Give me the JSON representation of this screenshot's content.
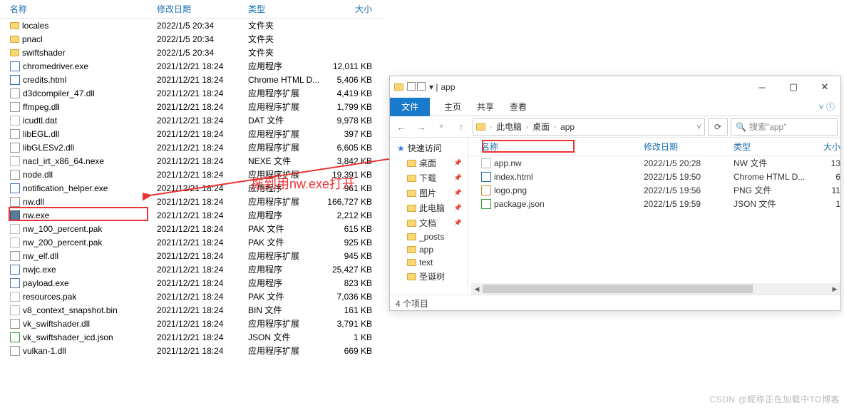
{
  "left": {
    "headers": {
      "name": "名称",
      "date": "修改日期",
      "type": "类型",
      "size": "大小"
    },
    "rows": [
      {
        "icon": "folder",
        "name": "locales",
        "date": "2022/1/5 20:34",
        "type": "文件夹",
        "size": ""
      },
      {
        "icon": "folder",
        "name": "pnacl",
        "date": "2022/1/5 20:34",
        "type": "文件夹",
        "size": ""
      },
      {
        "icon": "folder",
        "name": "swiftshader",
        "date": "2022/1/5 20:34",
        "type": "文件夹",
        "size": ""
      },
      {
        "icon": "exe",
        "name": "chromedriver.exe",
        "date": "2021/12/21 18:24",
        "type": "应用程序",
        "size": "12,011 KB"
      },
      {
        "icon": "html",
        "name": "credits.html",
        "date": "2021/12/21 18:24",
        "type": "Chrome HTML D...",
        "size": "5,406 KB"
      },
      {
        "icon": "dll",
        "name": "d3dcompiler_47.dll",
        "date": "2021/12/21 18:24",
        "type": "应用程序扩展",
        "size": "4,419 KB"
      },
      {
        "icon": "dll",
        "name": "ffmpeg.dll",
        "date": "2021/12/21 18:24",
        "type": "应用程序扩展",
        "size": "1,799 KB"
      },
      {
        "icon": "file",
        "name": "icudtl.dat",
        "date": "2021/12/21 18:24",
        "type": "DAT 文件",
        "size": "9,978 KB"
      },
      {
        "icon": "dll",
        "name": "libEGL.dll",
        "date": "2021/12/21 18:24",
        "type": "应用程序扩展",
        "size": "397 KB"
      },
      {
        "icon": "dll",
        "name": "libGLESv2.dll",
        "date": "2021/12/21 18:24",
        "type": "应用程序扩展",
        "size": "6,605 KB"
      },
      {
        "icon": "file",
        "name": "nacl_irt_x86_64.nexe",
        "date": "2021/12/21 18:24",
        "type": "NEXE 文件",
        "size": "3,842 KB"
      },
      {
        "icon": "dll",
        "name": "node.dll",
        "date": "2021/12/21 18:24",
        "type": "应用程序扩展",
        "size": "19,391 KB"
      },
      {
        "icon": "exe",
        "name": "notification_helper.exe",
        "date": "2021/12/21 18:24",
        "type": "应用程序",
        "size": "961 KB"
      },
      {
        "icon": "dll",
        "name": "nw.dll",
        "date": "2021/12/21 18:24",
        "type": "应用程序扩展",
        "size": "166,727 KB"
      },
      {
        "icon": "nw",
        "name": "nw.exe",
        "date": "2021/12/21 18:24",
        "type": "应用程序",
        "size": "2,212 KB"
      },
      {
        "icon": "file",
        "name": "nw_100_percent.pak",
        "date": "2021/12/21 18:24",
        "type": "PAK 文件",
        "size": "615 KB"
      },
      {
        "icon": "file",
        "name": "nw_200_percent.pak",
        "date": "2021/12/21 18:24",
        "type": "PAK 文件",
        "size": "925 KB"
      },
      {
        "icon": "dll",
        "name": "nw_elf.dll",
        "date": "2021/12/21 18:24",
        "type": "应用程序扩展",
        "size": "945 KB"
      },
      {
        "icon": "exe",
        "name": "nwjc.exe",
        "date": "2021/12/21 18:24",
        "type": "应用程序",
        "size": "25,427 KB"
      },
      {
        "icon": "exe",
        "name": "payload.exe",
        "date": "2021/12/21 18:24",
        "type": "应用程序",
        "size": "823 KB"
      },
      {
        "icon": "file",
        "name": "resources.pak",
        "date": "2021/12/21 18:24",
        "type": "PAK 文件",
        "size": "7,036 KB"
      },
      {
        "icon": "file",
        "name": "v8_context_snapshot.bin",
        "date": "2021/12/21 18:24",
        "type": "BIN 文件",
        "size": "161 KB"
      },
      {
        "icon": "dll",
        "name": "vk_swiftshader.dll",
        "date": "2021/12/21 18:24",
        "type": "应用程序扩展",
        "size": "3,791 KB"
      },
      {
        "icon": "json",
        "name": "vk_swiftshader_icd.json",
        "date": "2021/12/21 18:24",
        "type": "JSON 文件",
        "size": "1 KB"
      },
      {
        "icon": "dll",
        "name": "vulkan-1.dll",
        "date": "2021/12/21 18:24",
        "type": "应用程序扩展",
        "size": "669 KB"
      }
    ]
  },
  "right": {
    "title": "app",
    "ribbon": {
      "file": "文件",
      "home": "主页",
      "share": "共享",
      "view": "查看"
    },
    "breadcrumb": [
      "此电脑",
      "桌面",
      "app"
    ],
    "search_placeholder": "搜索\"app\"",
    "headers": {
      "name": "名称",
      "date": "修改日期",
      "type": "类型",
      "size": "大小"
    },
    "nav": [
      {
        "label": "快速访问",
        "cls": "top",
        "icon": "star"
      },
      {
        "label": "桌面",
        "cls": "sub",
        "pin": true,
        "icon": "desktop"
      },
      {
        "label": "下载",
        "cls": "sub",
        "pin": true,
        "icon": "download"
      },
      {
        "label": "图片",
        "cls": "sub",
        "pin": true,
        "icon": "pictures"
      },
      {
        "label": "此电脑",
        "cls": "sub",
        "pin": true,
        "icon": "pc"
      },
      {
        "label": "文档",
        "cls": "sub",
        "pin": true,
        "icon": "docs"
      },
      {
        "label": "_posts",
        "cls": "sub",
        "icon": "folder"
      },
      {
        "label": "app",
        "cls": "sub",
        "icon": "folder"
      },
      {
        "label": "text",
        "cls": "sub",
        "icon": "folder"
      },
      {
        "label": "圣诞树",
        "cls": "sub",
        "icon": "folder"
      }
    ],
    "rows": [
      {
        "icon": "file",
        "name": "app.nw",
        "date": "2022/1/5 20:28",
        "type": "NW 文件",
        "size": "13"
      },
      {
        "icon": "html",
        "name": "index.html",
        "date": "2022/1/5 19:50",
        "type": "Chrome HTML D...",
        "size": "6"
      },
      {
        "icon": "png",
        "name": "logo.png",
        "date": "2022/1/5 19:56",
        "type": "PNG 文件",
        "size": "11"
      },
      {
        "icon": "json",
        "name": "package.json",
        "date": "2022/1/5 19:59",
        "type": "JSON 文件",
        "size": "1"
      }
    ],
    "status": "4 个项目"
  },
  "annotation": "拖到用nw.exe打开",
  "watermark": "CSDN @昵称正在加载中TO博客"
}
